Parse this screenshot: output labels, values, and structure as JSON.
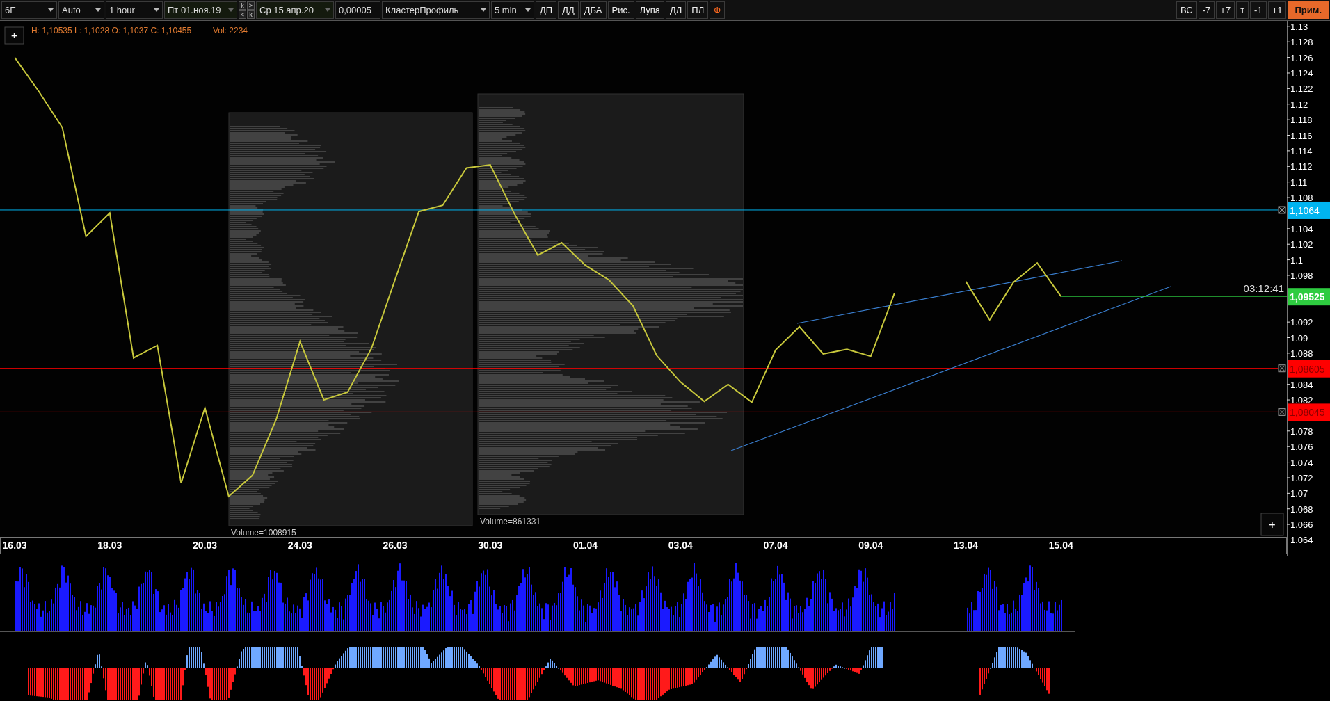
{
  "toolbar": {
    "symbol": "6E",
    "scale": "Auto",
    "timeframe": "1 hour",
    "date_from": "Пт 01.ноя.19",
    "nav_keys": [
      "k",
      ">",
      "<",
      "k"
    ],
    "date_to": "Ср 15.апр.20",
    "tick_size": "0,00005",
    "chart_type": "КластерПрофиль",
    "profile_period": "5 min",
    "buttons": [
      {
        "label": "ДП",
        "accent": false
      },
      {
        "label": "ДД",
        "accent": false
      },
      {
        "label": "ДБА",
        "accent": false
      },
      {
        "label": "Рис.",
        "accent": false
      },
      {
        "label": "Лупа",
        "accent": false
      },
      {
        "label": "ДЛ",
        "accent": false
      },
      {
        "label": "ПЛ",
        "accent": false
      },
      {
        "label": "Ф",
        "accent": true
      }
    ],
    "right_buttons": [
      {
        "label": "ВС",
        "accent": false
      },
      {
        "label": "-7",
        "accent": false
      },
      {
        "label": "+7",
        "accent": false
      },
      {
        "label": "т",
        "accent": false
      },
      {
        "label": "-1",
        "accent": false
      },
      {
        "label": "+1",
        "accent": false
      },
      {
        "label": "Прим.",
        "accent": true
      }
    ]
  },
  "chart": {
    "zoom_buttons": [
      "+",
      "+"
    ],
    "ohlc_readout": "H: 1,10535 L: 1,1028 O: 1,1037 C: 1,10455",
    "volume_readout": "Vol: 2234",
    "timer": "03:12:41",
    "current_price": "1,09525",
    "profiles": [
      {
        "label": "Volume=1008915"
      },
      {
        "label": "Volume=861331"
      }
    ],
    "levels": [
      {
        "label": "1,1064",
        "color": "#00b4f0"
      },
      {
        "label": "1,08605",
        "color": "#ff0000"
      },
      {
        "label": "1,08045",
        "color": "#ff0000"
      }
    ],
    "chart_data": {
      "type": "line",
      "ylim": [
        1.0619,
        1.1307
      ],
      "categories": [
        "16.03",
        null,
        null,
        null,
        "18.03",
        null,
        null,
        null,
        "20.03",
        null,
        null,
        null,
        "24.03",
        null,
        null,
        null,
        "26.03",
        null,
        null,
        null,
        "30.03",
        null,
        null,
        null,
        "01.04",
        null,
        null,
        null,
        "03.04",
        null,
        null,
        null,
        "07.04",
        null,
        null,
        null,
        "09.04",
        null,
        null,
        null,
        "13.04",
        null,
        null,
        null,
        "15.04",
        null,
        null,
        null,
        null,
        null,
        null,
        null,
        null,
        null
      ],
      "series": [
        {
          "color": "#c8c83c",
          "values": [
            1.126,
            1.1217,
            1.117,
            1.103,
            1.106,
            1.0874,
            1.089,
            1.0713,
            1.081,
            1.0696,
            1.0723,
            1.0795,
            1.0895,
            1.082,
            1.083,
            1.0886,
            1.0975,
            1.1062,
            1.107,
            1.1118,
            1.1122,
            1.106,
            1.1006,
            1.1022,
            1.0993,
            1.0974,
            1.0941,
            1.0877,
            1.0843,
            1.0818,
            1.084,
            1.0817,
            1.0884,
            1.0914,
            1.0879,
            1.0885,
            1.0876,
            1.0957,
            null,
            null,
            1.0972,
            1.0923,
            1.0971,
            1.0996,
            1.0953,
            null,
            null,
            null,
            null,
            null,
            null,
            null,
            null,
            null
          ]
        }
      ],
      "yticks": [
        1.13,
        1.128,
        1.126,
        1.124,
        1.122,
        1.12,
        1.118,
        1.116,
        1.114,
        1.112,
        1.11,
        1.108,
        1.104,
        1.102,
        1.1,
        1.098,
        1.092,
        1.09,
        1.088,
        1.084,
        1.082,
        1.078,
        1.076,
        1.074,
        1.072,
        1.07,
        1.068,
        1.066,
        1.064
      ]
    }
  }
}
